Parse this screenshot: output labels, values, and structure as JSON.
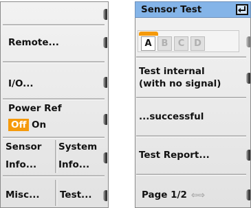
{
  "left_menu": {
    "remote_label": "Remote...",
    "io_label": "I/O...",
    "power_ref_label": "Power Ref",
    "power_ref_off": "Off",
    "power_ref_on": "On",
    "sensor_info_line1": "Sensor",
    "sensor_info_line2": "Info...",
    "system_info_line1": "System",
    "system_info_line2": "Info...",
    "misc_label": "Misc...",
    "test_label": "Test..."
  },
  "sensor_test_dialog": {
    "title": "Sensor Test",
    "tabs": [
      {
        "label": "A",
        "active": true
      },
      {
        "label": "B",
        "active": false
      },
      {
        "label": "C",
        "active": false
      },
      {
        "label": "D",
        "active": false
      }
    ],
    "test_internal_line1": "Test internal",
    "test_internal_line2": "(with no signal)",
    "result": "...successful",
    "test_report_label": "Test Report...",
    "page_label": "Page 1/2",
    "page_arrows": "⇦⇨"
  },
  "colors": {
    "accent_orange": "#f59a0c",
    "title_bar_blue": "#84b4e8"
  },
  "icons": [
    "softkey-arrow-icon",
    "return-key-icon",
    "page-arrows-icon"
  ]
}
